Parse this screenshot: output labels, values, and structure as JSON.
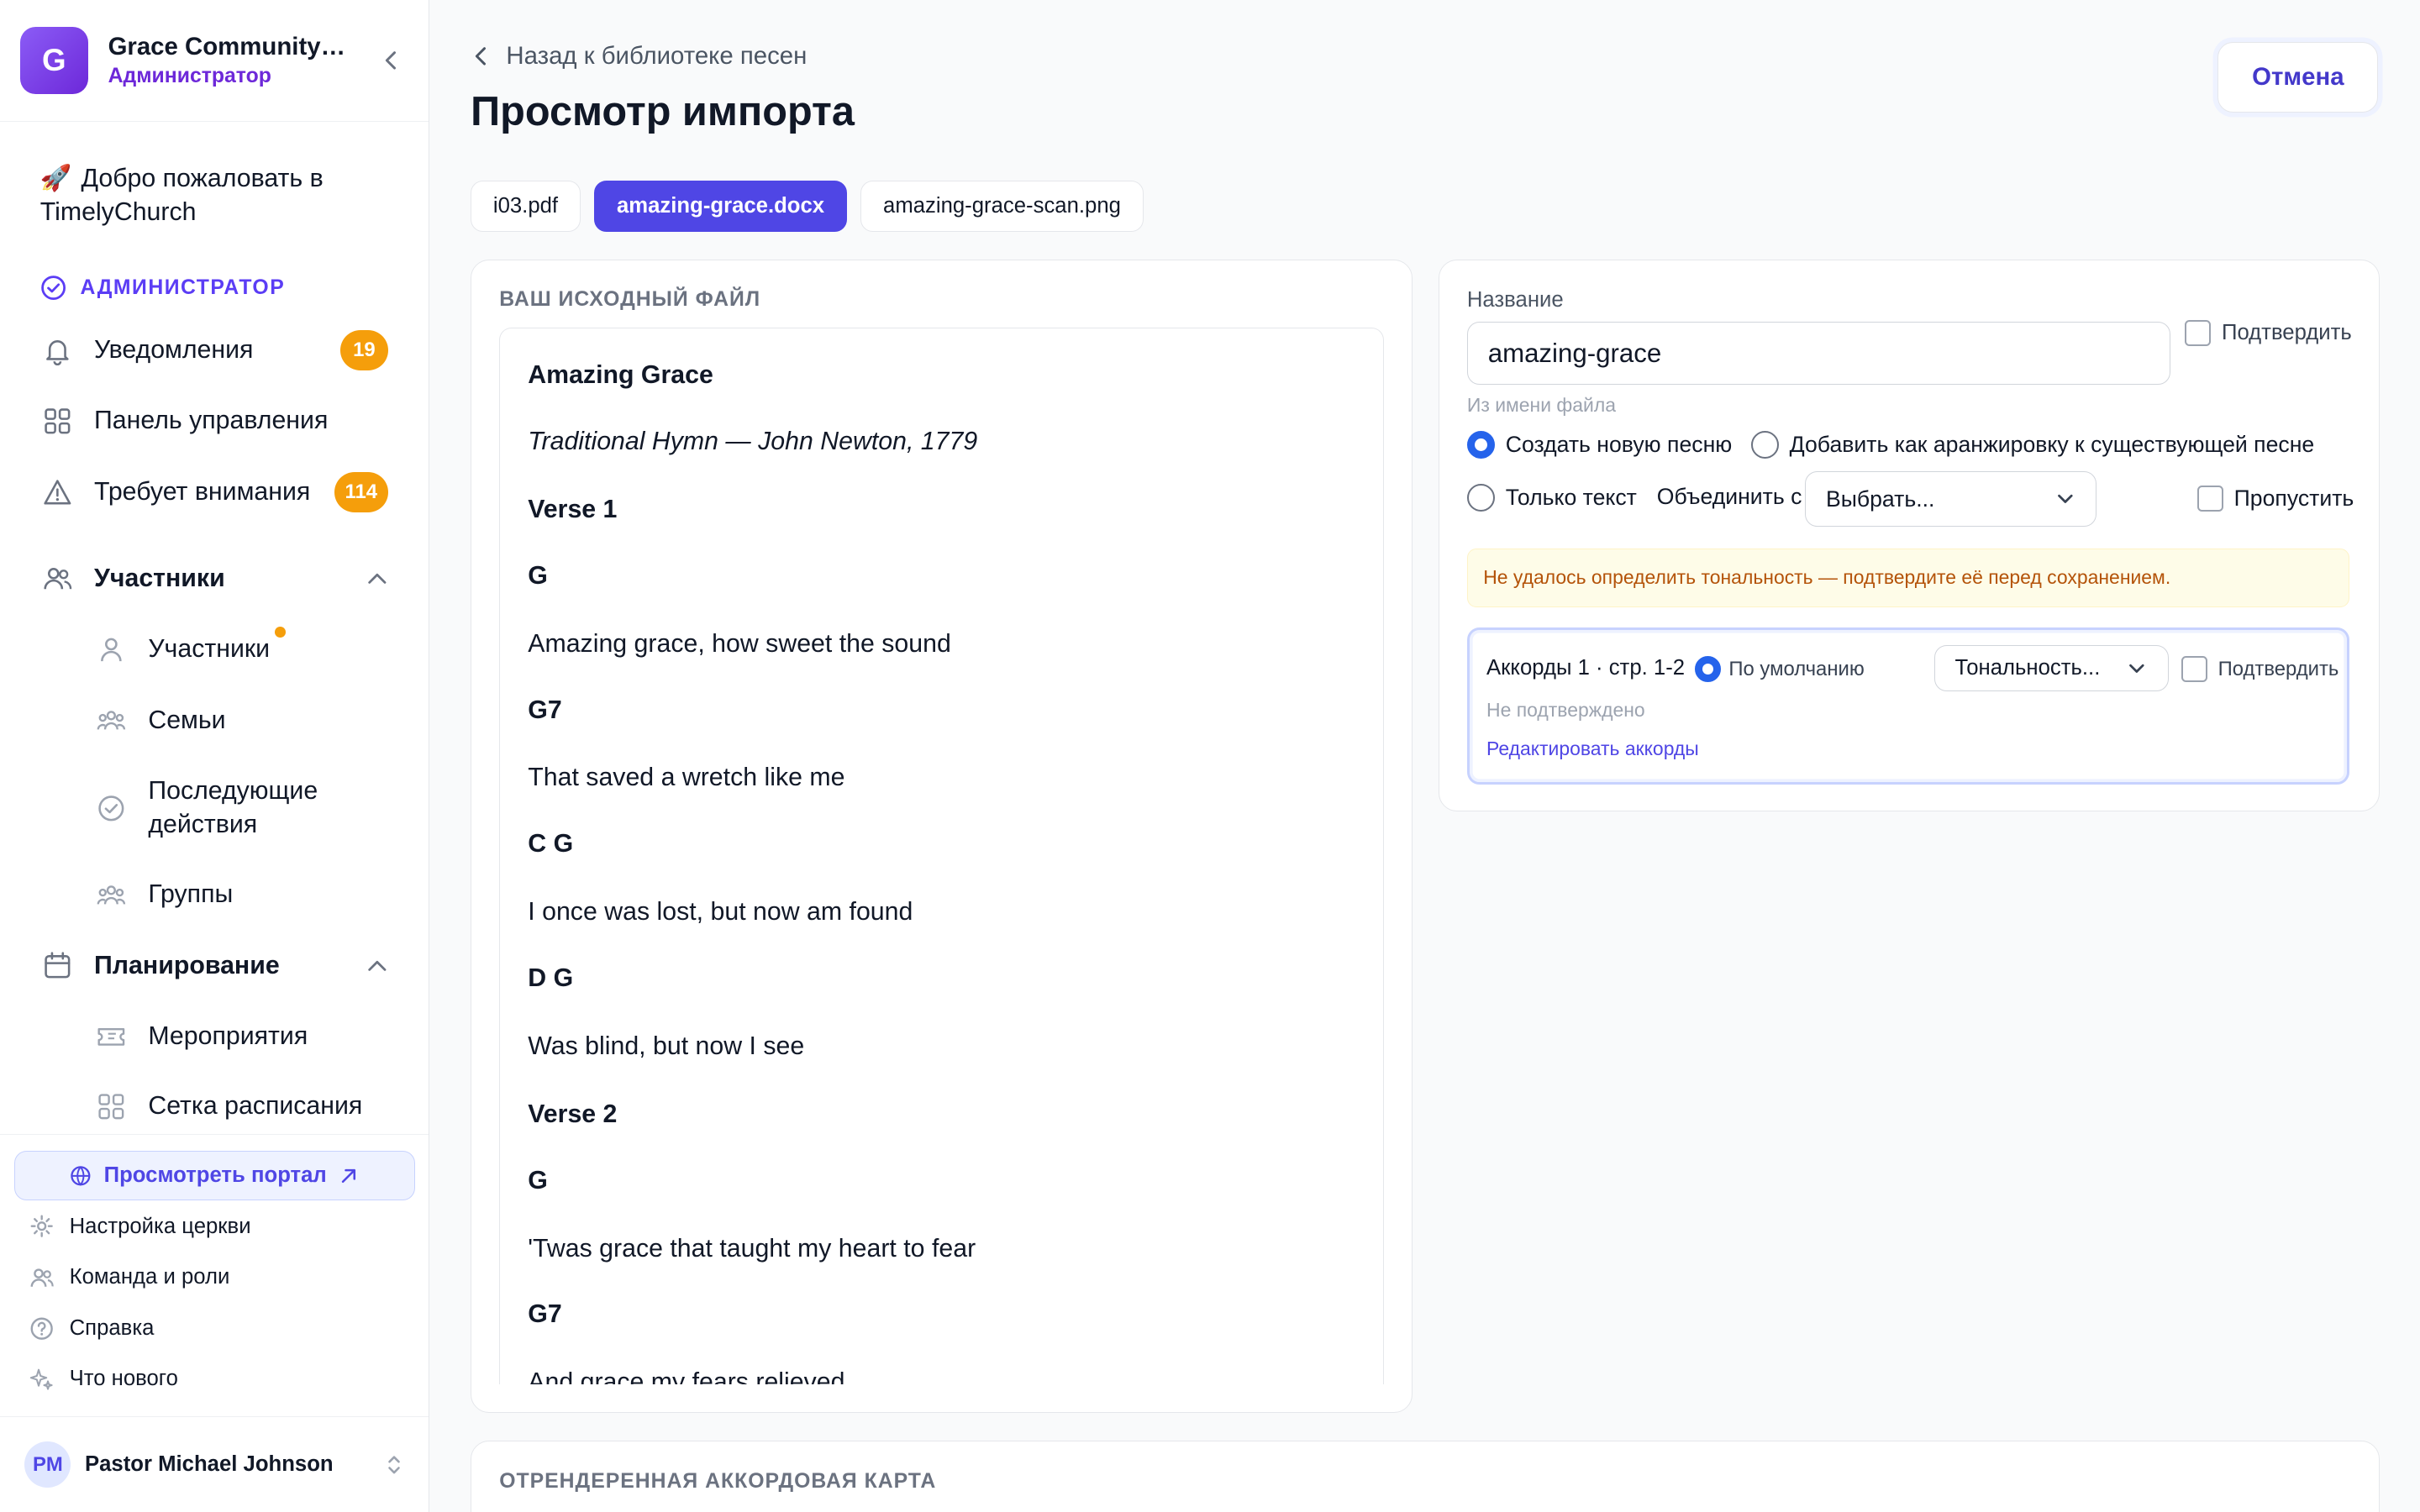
{
  "org": {
    "initial": "G",
    "name": "Grace Community Church",
    "role": "Администратор"
  },
  "welcome": {
    "emoji": "🚀",
    "text": "Добро пожаловать в TimelyChurch"
  },
  "sidebar": {
    "admin_section": "АДМИНИСТРАТОР",
    "notifications": {
      "label": "Уведомления",
      "badge": "19"
    },
    "dashboard": "Панель управления",
    "attention": {
      "label": "Требует внимания",
      "badge": "114"
    },
    "members_group": "Участники",
    "members_items": [
      "Участники",
      "Семьи",
      "Последующие действия",
      "Группы"
    ],
    "planning_group": "Планирование",
    "planning_items": [
      "Мероприятия",
      "Сетка расписания"
    ],
    "portal_button": "Просмотреть портал",
    "footer": [
      "Настройка церкви",
      "Команда и роли",
      "Справка",
      "Что нового"
    ],
    "user": {
      "initials": "PM",
      "name": "Pastor Michael Johnson"
    }
  },
  "header": {
    "back": "Назад к библиотеке песен",
    "title": "Просмотр импорта",
    "cancel": "Отмена"
  },
  "tabs": [
    "i03.pdf",
    "amazing-grace.docx",
    "amazing-grace-scan.png"
  ],
  "active_tab": "amazing-grace.docx",
  "source": {
    "label": "ВАШ ИСХОДНЫЙ ФАЙЛ",
    "lines": [
      {
        "text": "Amazing Grace",
        "style": "b"
      },
      {
        "text": "Traditional Hymn — John Newton, 1779",
        "style": "i"
      },
      {
        "text": "Verse 1",
        "style": "b"
      },
      {
        "text": "G",
        "style": "b"
      },
      {
        "text": "Amazing grace, how sweet the sound",
        "style": ""
      },
      {
        "text": "G7",
        "style": "b"
      },
      {
        "text": "That saved a wretch like me",
        "style": ""
      },
      {
        "text": "C G",
        "style": "b"
      },
      {
        "text": "I once was lost, but now am found",
        "style": ""
      },
      {
        "text": "D G",
        "style": "b"
      },
      {
        "text": "Was blind, but now I see",
        "style": ""
      },
      {
        "text": "Verse 2",
        "style": "b"
      },
      {
        "text": "G",
        "style": "b"
      },
      {
        "text": "'Twas grace that taught my heart to fear",
        "style": ""
      },
      {
        "text": "G7",
        "style": "b"
      },
      {
        "text": "And grace my fears relieved",
        "style": ""
      }
    ]
  },
  "form": {
    "name_label": "Название",
    "name_value": "amazing-grace",
    "confirm": "Подтвердить",
    "name_hint": "Из имени файла",
    "option_new": "Создать новую песню",
    "option_arrangement": "Добавить как аранжировку к существующей песне",
    "option_text_only": "Только текст",
    "merge_label": "Объединить с",
    "merge_select": "Выбрать...",
    "skip": "Пропустить",
    "warning": "Не удалось определить тональность — подтвердите её перед сохранением.",
    "chords": {
      "title": "Аккорды 1 · стр. 1-2",
      "default": "По умолчанию",
      "key_select": "Тональность...",
      "confirm": "Подтвердить",
      "status": "Не подтверждено",
      "edit": "Редактировать аккорды"
    }
  },
  "rendered": {
    "label": "ОТРЕНДЕРЕННАЯ АККОРДОВАЯ КАРТА"
  },
  "colors": {
    "accent": "#4f46e5",
    "badge": "#f59e0b",
    "warning_text": "#b45309"
  }
}
